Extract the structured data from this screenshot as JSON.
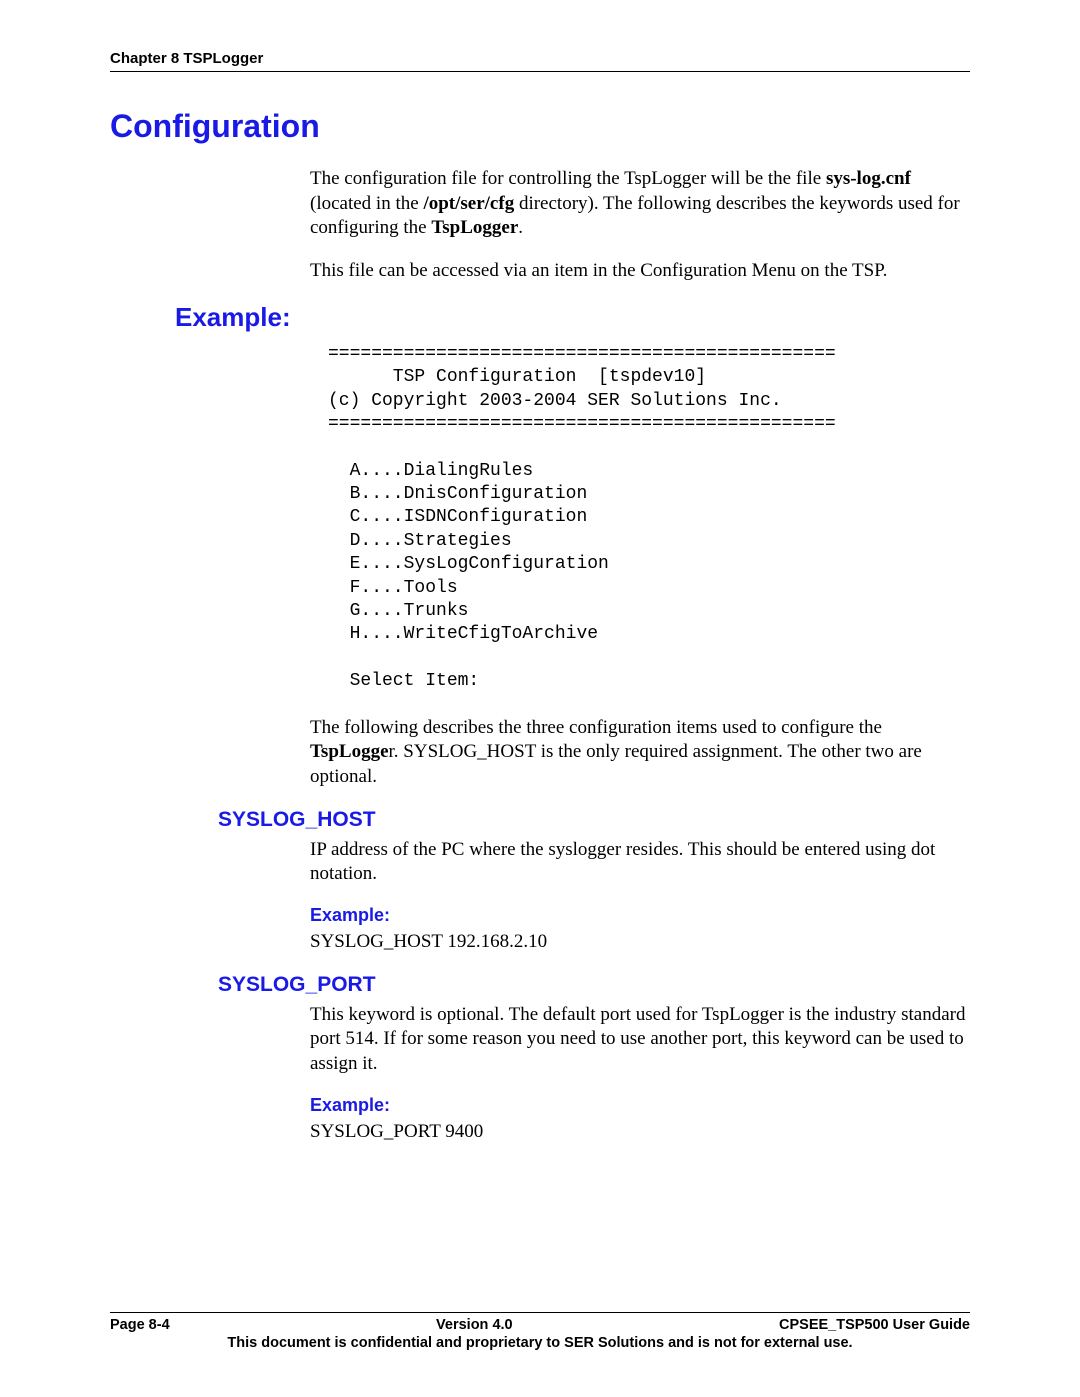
{
  "header": {
    "chapter": "Chapter 8 TSPLogger"
  },
  "title": "Configuration",
  "intro1_parts": [
    "The configuration file for controlling the TspLogger will be the file ",
    "sys-log.cnf",
    " (located in the ",
    "/opt/ser/cfg",
    " directory).  The following describes the keywords used for configuring the ",
    "TspLogger",
    "."
  ],
  "intro2": "This file can be accessed via an item in the Configuration Menu on the TSP.",
  "example_heading": "Example:",
  "code": "===============================================\n      TSP Configuration  [tspdev10]\n(c) Copyright 2003-2004 SER Solutions Inc.\n===============================================\n\n  A....DialingRules\n  B....DnisConfiguration\n  C....ISDNConfiguration\n  D....Strategies\n  E....SysLogConfiguration\n  F....Tools\n  G....Trunks\n  H....WriteCfigToArchive\n\n  Select Item:",
  "after_code_parts": [
    "The following describes the three configuration items used to configure the ",
    "TspLogge",
    "r.  SYSLOG_HOST is the only required assignment. The other two are optional."
  ],
  "sections": {
    "syslog_host": {
      "title": "SYSLOG_HOST",
      "desc": "IP address of the PC where the syslogger resides.  This should be entered using dot notation.",
      "example_label": "Example:",
      "example_value": "SYSLOG_HOST 192.168.2.10"
    },
    "syslog_port": {
      "title": "SYSLOG_PORT",
      "desc": "This keyword is optional.  The default port used for TspLogger is the industry standard port 514. If for some reason you need to use another port, this keyword can be used to assign it.",
      "example_label": "Example:",
      "example_value": "SYSLOG_PORT  9400"
    }
  },
  "footer": {
    "left": "Page 8-4",
    "center": "Version 4.0",
    "right": "CPSEE_TSP500 User Guide",
    "notice": "This document is confidential and proprietary to SER Solutions and is not for external use."
  }
}
